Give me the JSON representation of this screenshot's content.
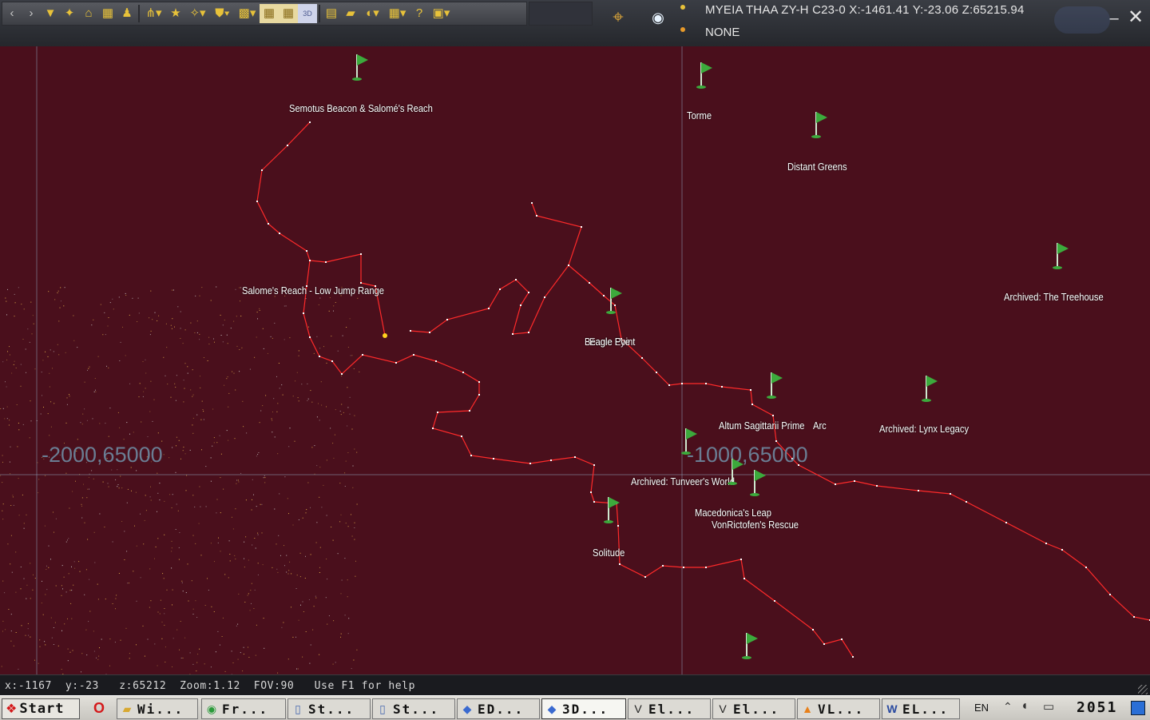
{
  "window": {
    "current_system": "MYEIA THAA ZY-H C23-0 X:-1461.41 Y:-23.06 Z:65215.94",
    "target_system": "NONE",
    "minimize_glyph": "–",
    "close_glyph": "✕"
  },
  "toolbar": {
    "icons": [
      "chevron-left-icon",
      "chevron-right-icon",
      "galaxy-filter-icon",
      "star-names-icon",
      "home-icon",
      "grid-icon",
      "person-icon",
      "route-icon",
      "bookmark-star-icon",
      "star-plus-icon",
      "shield-icon",
      "pattern-icon",
      "grid-tile-icon",
      "grid-tile-icon",
      "label-2d-icon",
      "ruler-icon",
      "parallelogram-icon",
      "orbit-icon",
      "table-icon",
      "help-icon",
      "camera-icon"
    ],
    "tile_label": "3D",
    "help_glyph": "?"
  },
  "map": {
    "grid_labels": [
      {
        "text": "-2000,65000"
      },
      {
        "text": "-1000,65000"
      }
    ],
    "labels": [
      "Semotus Beacon & Salomé's Reach",
      "Torme",
      "Distant Greens",
      "Archived: The Treehouse",
      "Salome's Reach - Low Jump Range",
      "Beagle Point",
      "Eagle Eye",
      "Altum Sagittarii Prime",
      "Arc",
      "Archived: Lynx Legacy",
      "Archived: Tunveer's World",
      "Macedonica's Leap",
      "VonRictofen's Rescue",
      "Solitude"
    ],
    "colors": {
      "route": "#ff2a2a",
      "flag": "#3caa3c",
      "background": "#4a0f1c",
      "grid": "#8aa0b8"
    }
  },
  "status": {
    "text": "x:-1167  y:-23   z:65212  Zoom:1.12  FOV:90   Use F1 for help"
  },
  "taskbar": {
    "start_label": "Start",
    "tasks": [
      {
        "label": "Wi...",
        "icon": "folder-icon"
      },
      {
        "label": "Fr...",
        "icon": "chrome-icon"
      },
      {
        "label": "St...",
        "icon": "document-icon"
      },
      {
        "label": "St...",
        "icon": "document-icon"
      },
      {
        "label": "ED...",
        "icon": "ship-icon"
      },
      {
        "label": "3D...",
        "icon": "ship-icon",
        "active": true
      },
      {
        "label": "El...",
        "icon": "elite-icon"
      },
      {
        "label": "El...",
        "icon": "elite-icon"
      },
      {
        "label": "VL...",
        "icon": "vlc-icon"
      },
      {
        "label": "EL...",
        "icon": "word-icon"
      }
    ],
    "language": "EN",
    "clock": "2051"
  }
}
